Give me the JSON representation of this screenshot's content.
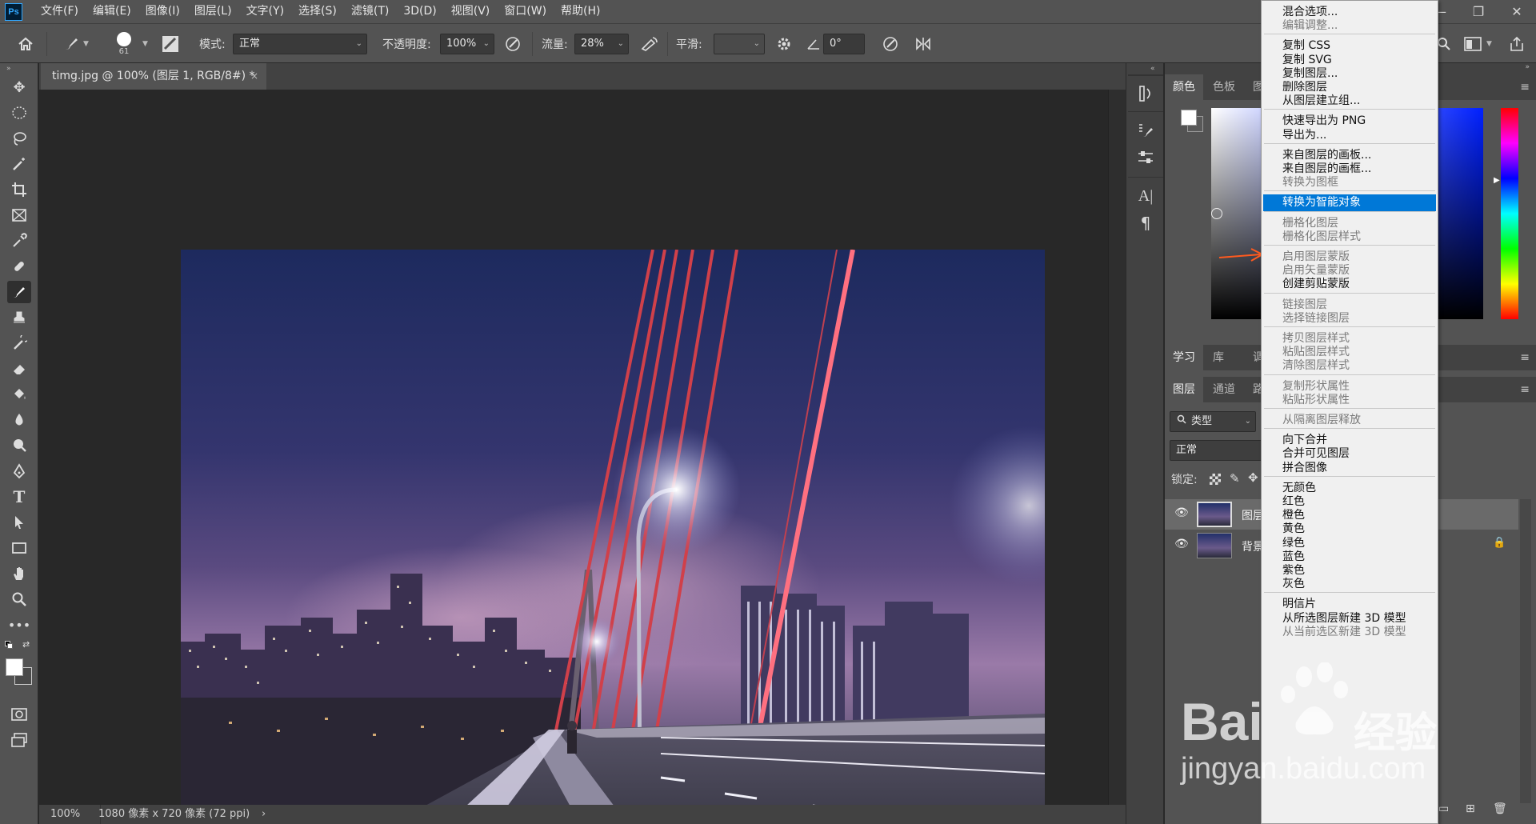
{
  "menubar": {
    "logo": "Ps",
    "items": [
      "文件(F)",
      "编辑(E)",
      "图像(I)",
      "图层(L)",
      "文字(Y)",
      "选择(S)",
      "滤镜(T)",
      "3D(D)",
      "视图(V)",
      "窗口(W)",
      "帮助(H)"
    ]
  },
  "options": {
    "brush_size": "61",
    "mode_label": "模式:",
    "mode_value": "正常",
    "opacity_label": "不透明度:",
    "opacity_value": "100%",
    "flow_label": "流量:",
    "flow_value": "28%",
    "smoothing_label": "平滑:",
    "smoothing_value": "",
    "angle_value": "0°"
  },
  "document": {
    "tab_title": "timg.jpg @ 100% (图层 1, RGB/8#) *",
    "close": "×",
    "zoom": "100%",
    "doc_info": "1080 像素 x 720 像素 (72 ppi)",
    "status_arrow": "›"
  },
  "panels": {
    "color_tabs": [
      "颜色",
      "色板",
      "图"
    ],
    "learn_tabs": [
      "学习",
      "库",
      "调"
    ],
    "layer_tabs": [
      "图层",
      "通道",
      "路"
    ],
    "filter_kind": "类型",
    "blend_mode": "正常",
    "lock_label": "锁定:",
    "layers": [
      {
        "name": "图层",
        "selected": true,
        "locked": false
      },
      {
        "name": "背景",
        "selected": false,
        "locked": true
      }
    ],
    "menu_icon": "≡"
  },
  "context_menu": {
    "groups": [
      [
        {
          "label": "混合选项...",
          "disabled": false
        },
        {
          "label": "编辑调整...",
          "disabled": true
        }
      ],
      [
        {
          "label": "复制 CSS",
          "disabled": false
        },
        {
          "label": "复制 SVG",
          "disabled": false
        },
        {
          "label": "复制图层...",
          "disabled": false
        },
        {
          "label": "删除图层",
          "disabled": false
        },
        {
          "label": "从图层建立组...",
          "disabled": false
        }
      ],
      [
        {
          "label": "快速导出为 PNG",
          "disabled": false
        },
        {
          "label": "导出为...",
          "disabled": false
        }
      ],
      [
        {
          "label": "来自图层的画板...",
          "disabled": false
        },
        {
          "label": "来自图层的画框...",
          "disabled": false
        },
        {
          "label": "转换为图框",
          "disabled": true
        }
      ],
      [
        {
          "label": "转换为智能对象",
          "disabled": false,
          "highlighted": true
        }
      ],
      [
        {
          "label": "栅格化图层",
          "disabled": true
        },
        {
          "label": "栅格化图层样式",
          "disabled": true
        }
      ],
      [
        {
          "label": "启用图层蒙版",
          "disabled": true
        },
        {
          "label": "启用矢量蒙版",
          "disabled": true
        },
        {
          "label": "创建剪贴蒙版",
          "disabled": false
        }
      ],
      [
        {
          "label": "链接图层",
          "disabled": true
        },
        {
          "label": "选择链接图层",
          "disabled": true
        }
      ],
      [
        {
          "label": "拷贝图层样式",
          "disabled": true
        },
        {
          "label": "粘贴图层样式",
          "disabled": true
        },
        {
          "label": "清除图层样式",
          "disabled": true
        }
      ],
      [
        {
          "label": "复制形状属性",
          "disabled": true
        },
        {
          "label": "粘贴形状属性",
          "disabled": true
        }
      ],
      [
        {
          "label": "从隔离图层释放",
          "disabled": true
        }
      ],
      [
        {
          "label": "向下合并",
          "disabled": false
        },
        {
          "label": "合并可见图层",
          "disabled": false
        },
        {
          "label": "拼合图像",
          "disabled": false
        }
      ],
      [
        {
          "label": "无颜色",
          "disabled": false
        },
        {
          "label": "红色",
          "disabled": false
        },
        {
          "label": "橙色",
          "disabled": false
        },
        {
          "label": "黄色",
          "disabled": false
        },
        {
          "label": "绿色",
          "disabled": false
        },
        {
          "label": "蓝色",
          "disabled": false
        },
        {
          "label": "紫色",
          "disabled": false
        },
        {
          "label": "灰色",
          "disabled": false
        }
      ],
      [
        {
          "label": "明信片",
          "disabled": false
        },
        {
          "label": "从所选图层新建 3D 模型",
          "disabled": false
        },
        {
          "label": "从当前选区新建 3D 模型",
          "disabled": true
        }
      ]
    ]
  },
  "watermark": {
    "brand": "Bai",
    "brand_cn": "经验",
    "url": "jingyan.baidu.com"
  },
  "colors": {
    "ui_bg": "#535353",
    "canvas_bg": "#282828",
    "highlight": "#0078d7",
    "annotation_arrow": "#ff5a1f"
  }
}
